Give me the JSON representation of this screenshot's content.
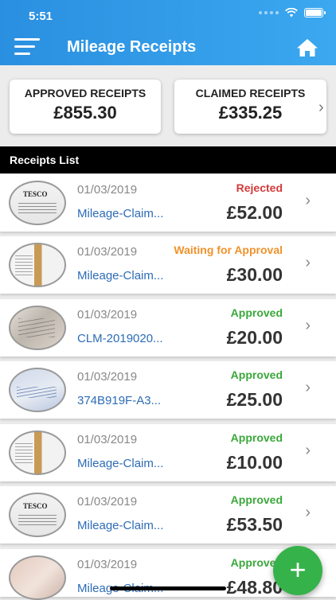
{
  "status_bar": {
    "time": "5:51"
  },
  "header": {
    "title": "Mileage Receipts"
  },
  "summary": {
    "approved": {
      "label": "APPROVED RECEIPTS",
      "value": "£855.30"
    },
    "claimed": {
      "label": "CLAIMED RECEIPTS",
      "value": "£335.25"
    }
  },
  "list": {
    "title": "Receipts List",
    "items": [
      {
        "date": "01/03/2019",
        "ref": "Mileage-Claim...",
        "status": "Rejected",
        "amount": "£52.00"
      },
      {
        "date": "01/03/2019",
        "ref": "Mileage-Claim...",
        "status": "Waiting for Approval",
        "amount": "£30.00"
      },
      {
        "date": "01/03/2019",
        "ref": "CLM-2019020...",
        "status": "Approved",
        "amount": "£20.00"
      },
      {
        "date": "01/03/2019",
        "ref": "374B919F-A3...",
        "status": "Approved",
        "amount": "£25.00"
      },
      {
        "date": "01/03/2019",
        "ref": "Mileage-Claim...",
        "status": "Approved",
        "amount": "£10.00"
      },
      {
        "date": "01/03/2019",
        "ref": "Mileage-Claim...",
        "status": "Approved",
        "amount": "£53.50"
      },
      {
        "date": "01/03/2019",
        "ref": "Mileage-Claim...",
        "status": "Approved",
        "amount": "£48.80"
      }
    ]
  },
  "fab": {
    "label": "+"
  },
  "icons": {
    "menu": "hamburger-menu-icon",
    "home": "home-icon",
    "wifi": "wifi-icon",
    "battery": "battery-icon",
    "chevron": "chevron-right-icon",
    "add": "plus-icon"
  },
  "colors": {
    "header": "#2a8fe0",
    "rejected": "#d43a3a",
    "waiting": "#f0922b",
    "approved": "#3aa83a",
    "link": "#2d6cb5",
    "fab": "#36b24a"
  }
}
